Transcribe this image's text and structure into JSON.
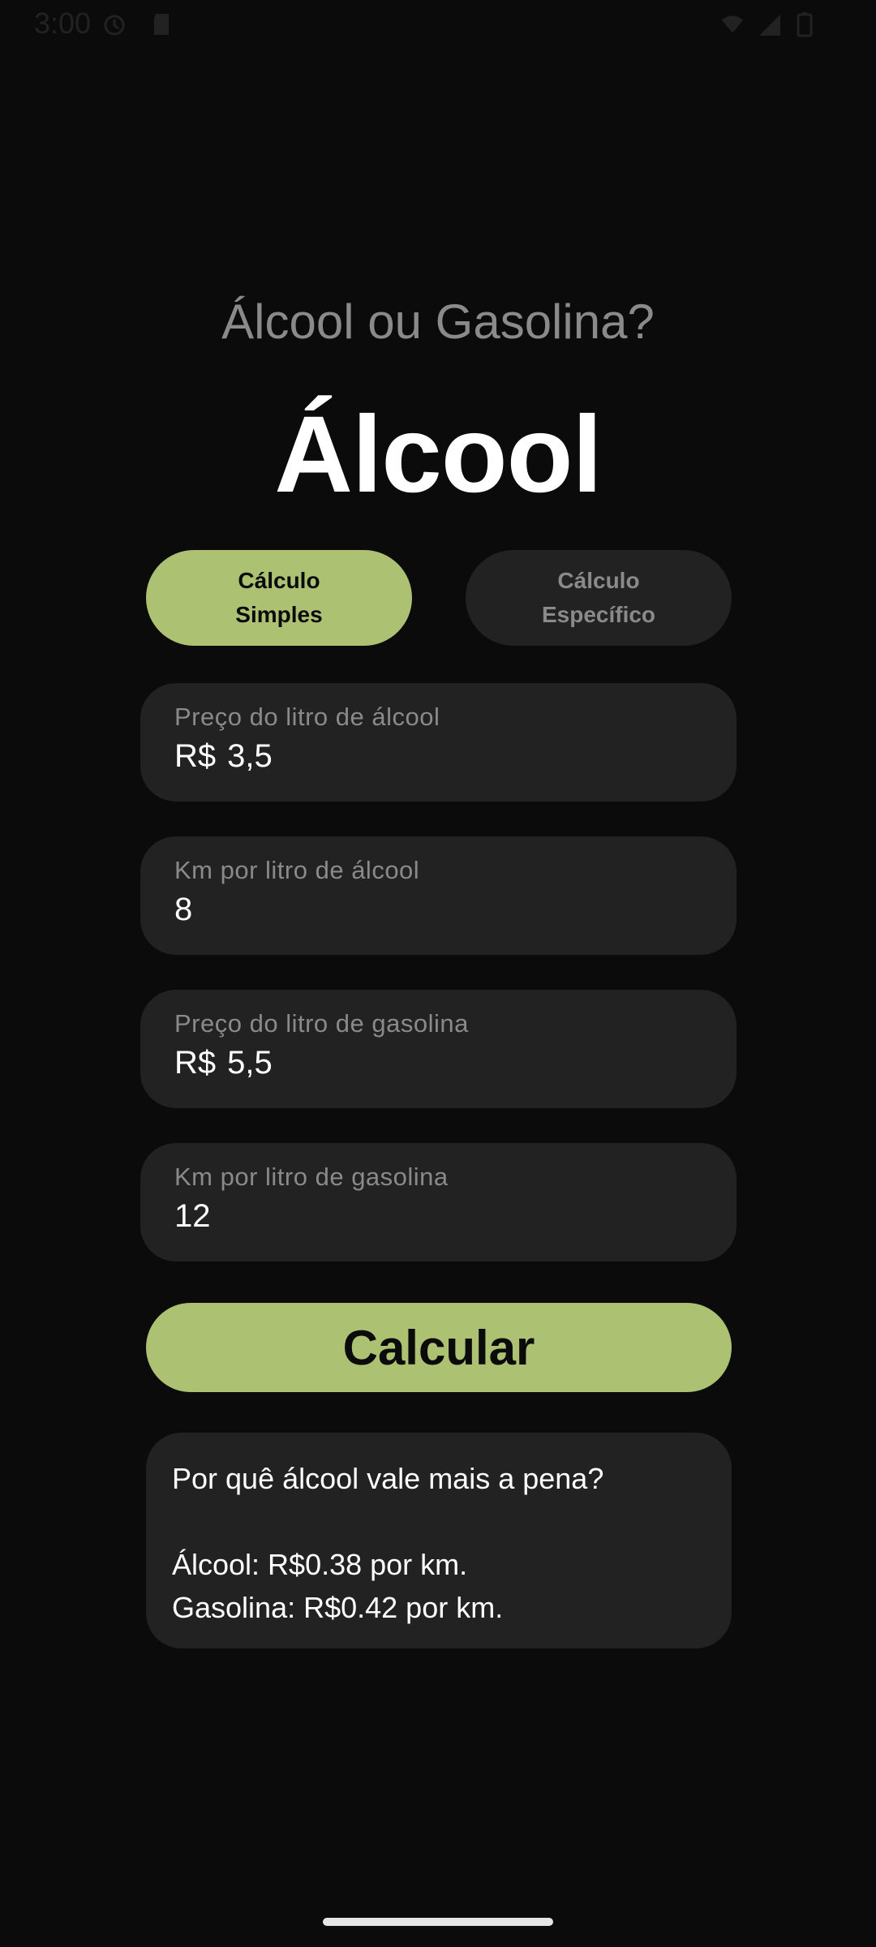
{
  "status_bar": {
    "time": "3:00",
    "icons": [
      "alarm-icon",
      "sd-card-icon",
      "wifi-icon",
      "signal-icon",
      "battery-icon"
    ]
  },
  "header": {
    "subtitle": "Álcool ou Gasolina?",
    "result": "Álcool"
  },
  "modes": {
    "simple": {
      "line1": "Cálculo",
      "line2": "Simples",
      "selected": true
    },
    "specific": {
      "line1": "Cálculo",
      "line2": "Específico",
      "selected": false
    }
  },
  "fields": {
    "alcohol_price": {
      "label": "Preço do litro de álcool",
      "prefix": "R$",
      "value": "3,5"
    },
    "alcohol_km": {
      "label": "Km por litro de álcool",
      "value": "8"
    },
    "gas_price": {
      "label": "Preço do litro de gasolina",
      "prefix": "R$",
      "value": "5,5"
    },
    "gas_km": {
      "label": "Km por litro de gasolina",
      "value": "12"
    }
  },
  "calculate_label": "Calcular",
  "result_card": {
    "question": "Por quê álcool vale mais a pena?",
    "alcohol_line": "Álcool: R$0.38 por km.",
    "gas_line": "Gasolina: R$0.42 por km."
  },
  "colors": {
    "background": "#0b0b0b",
    "accent": "#adc173",
    "surface": "#222222",
    "muted_text": "#8a8a8a"
  }
}
